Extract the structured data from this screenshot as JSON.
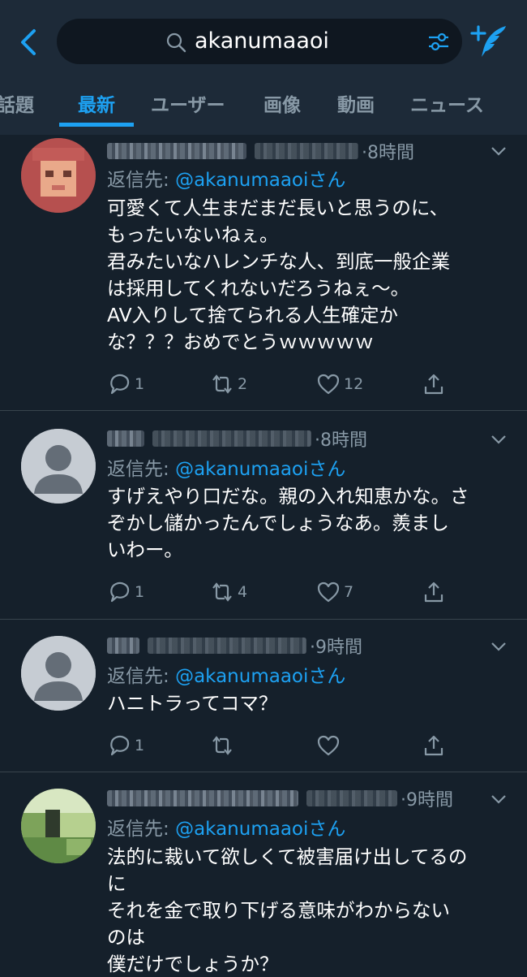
{
  "search": {
    "query": "akanumaaoi"
  },
  "tabs": [
    "話題",
    "最新",
    "ユーザー",
    "画像",
    "動画",
    "ニュース"
  ],
  "active_tab": "最新",
  "tweets": [
    {
      "time": "·8時間",
      "reply_prefix": "返信先: ",
      "reply_mention": "@akanumaaoiさん",
      "lines": [
        "可愛くて人生まだまだ長いと思うのに、",
        "もったいないねぇ。",
        "君みたいなハレンチな人、到底一般企業",
        "は採用してくれないだろうねぇ〜。",
        "AV入りして捨てられる人生確定か",
        "な？？？おめでとうｗｗｗｗｗ"
      ],
      "replies": "1",
      "retweets": "2",
      "likes": "12"
    },
    {
      "time": "·8時間",
      "reply_prefix": "返信先: ",
      "reply_mention": "@akanumaaoiさん",
      "lines": [
        "すげえやり口だな。親の入れ知恵かな。さ",
        "ぞかし儲かったんでしょうなあ。羨まし",
        "いわー。"
      ],
      "replies": "1",
      "retweets": "4",
      "likes": "7"
    },
    {
      "time": "·9時間",
      "reply_prefix": "返信先: ",
      "reply_mention": "@akanumaaoiさん",
      "lines": [
        "ハニトラってコマ？"
      ],
      "replies": "1",
      "retweets": "",
      "likes": ""
    },
    {
      "time": "·9時間",
      "reply_prefix": "返信先: ",
      "reply_mention": "@akanumaaoiさん",
      "lines": [
        "法的に裁いて欲しくて被害届け出してるの",
        "に",
        "それを金で取り下げる意味がわからない",
        "のは",
        "僕だけでしょうか？"
      ],
      "replies": "",
      "retweets": "",
      "likes": ""
    }
  ],
  "colors": {
    "accent": "#1da1f2",
    "background": "#15202b",
    "header": "#1d2a38",
    "muted": "#8899a6"
  }
}
